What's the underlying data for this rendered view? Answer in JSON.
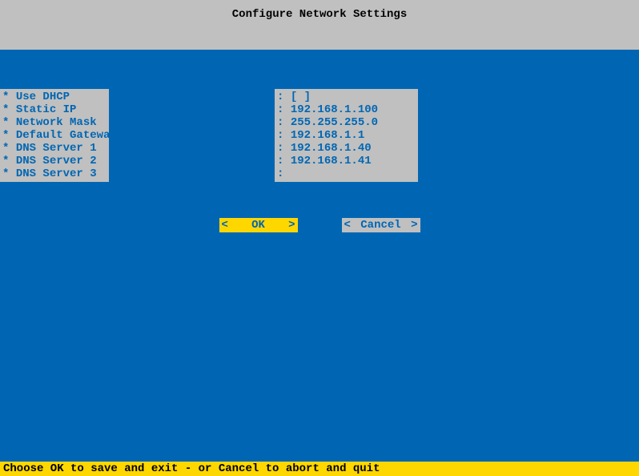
{
  "header": {
    "title": "Configure Network Settings"
  },
  "fields": {
    "bullet": "*",
    "separator": ":",
    "items": [
      {
        "label": "Use DHCP",
        "value": "[ ]"
      },
      {
        "label": "Static IP",
        "value": "192.168.1.100"
      },
      {
        "label": "Network Mask",
        "value": "255.255.255.0"
      },
      {
        "label": "Default Gateway",
        "value": "192.168.1.1"
      },
      {
        "label": "DNS Server 1",
        "value": "192.168.1.40"
      },
      {
        "label": "DNS Server 2",
        "value": "192.168.1.41"
      },
      {
        "label": "DNS Server 3",
        "value": ""
      }
    ]
  },
  "buttons": {
    "ok_label": "OK",
    "cancel_label": "Cancel",
    "bracket_left": "<",
    "bracket_right": ">"
  },
  "footer": {
    "text": "Choose OK to save and exit - or Cancel to abort and quit"
  }
}
